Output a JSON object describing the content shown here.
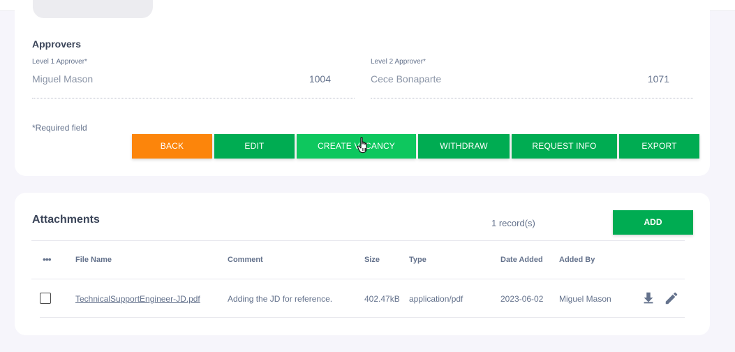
{
  "approvers": {
    "title": "Approvers",
    "level1": {
      "label": "Level 1 Approver*",
      "name": "Miguel Mason",
      "id": "1004"
    },
    "level2": {
      "label": "Level 2 Approver*",
      "name": "Cece Bonaparte",
      "id": "1071"
    }
  },
  "required_note": "*Required field",
  "actions": {
    "back": "BACK",
    "edit": "EDIT",
    "create_vacancy": "CREATE VACANCY",
    "withdraw": "WITHDRAW",
    "request_info": "REQUEST INFO",
    "export": "EXPORT"
  },
  "attachments": {
    "title": "Attachments",
    "records": "1 record(s)",
    "add_label": "ADD",
    "columns": {
      "more": "•••",
      "file_name": "File Name",
      "comment": "Comment",
      "size": "Size",
      "type": "Type",
      "date_added": "Date Added",
      "added_by": "Added By"
    },
    "rows": [
      {
        "file_name": "TechnicalSupportEngineer-JD.pdf",
        "comment": "Adding the JD for reference.",
        "size": "402.47kB",
        "type": "application/pdf",
        "date_added": "2023-06-02",
        "added_by": "Miguel Mason"
      }
    ]
  },
  "colors": {
    "accent_green": "#00ac52",
    "hover_green": "#0ec75e",
    "accent_orange": "#fc850b",
    "background": "#f6f5fb"
  },
  "icons": [
    "download-icon",
    "edit-pencil-icon",
    "hand-pointer-cursor-icon"
  ]
}
